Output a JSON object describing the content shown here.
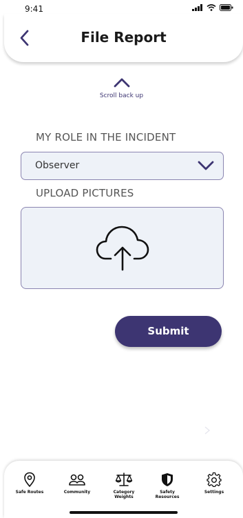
{
  "status_bar": {
    "time": "9:41"
  },
  "header": {
    "title": "File Report"
  },
  "scroll_up": {
    "label": "Scroll back up"
  },
  "form": {
    "role_label": "MY ROLE IN THE INCIDENT",
    "role_value": "Observer",
    "upload_label": "UPLOAD PICTURES",
    "submit_label": "Submit"
  },
  "bottom_nav": {
    "items": [
      {
        "label": "Safe Routes",
        "icon": "location-pin-icon"
      },
      {
        "label": "Community",
        "icon": "people-icon"
      },
      {
        "label": "Category\nWeights",
        "icon": "scale-icon"
      },
      {
        "label": "Safety\nResources",
        "icon": "shield-icon"
      },
      {
        "label": "Settings",
        "icon": "gear-icon"
      }
    ]
  },
  "colors": {
    "accent": "#3d3572",
    "field_background": "#eef2f8",
    "field_border": "#8a84b0"
  }
}
